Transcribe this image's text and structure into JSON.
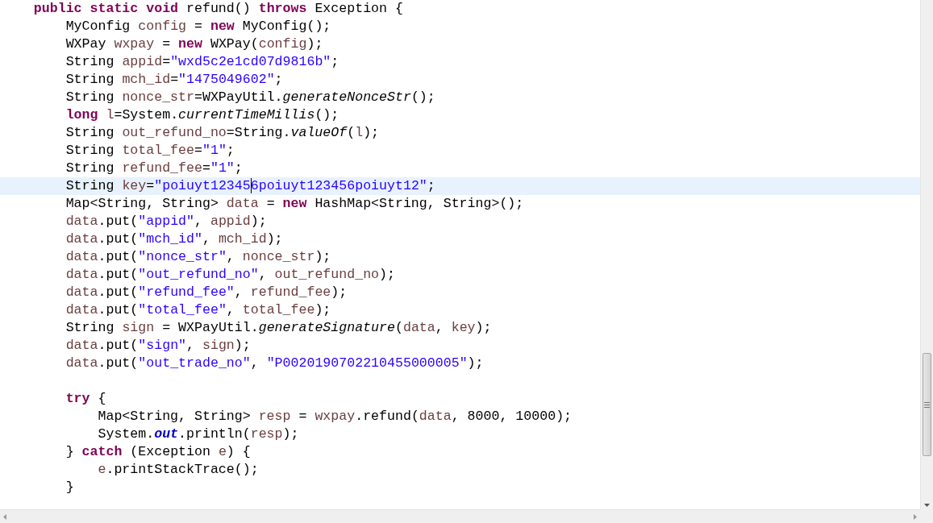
{
  "editor": {
    "lines": [
      {
        "current": false,
        "tokens": [
          {
            "text": "    public static void",
            "kind": "keyword"
          },
          {
            "text": " refund() ",
            "kind": "plain"
          },
          {
            "text": "throws",
            "kind": "keyword"
          },
          {
            "text": " Exception {",
            "kind": "plain"
          }
        ]
      },
      {
        "current": false,
        "tokens": [
          {
            "text": "        MyConfig ",
            "kind": "plain"
          },
          {
            "text": "config",
            "kind": "local"
          },
          {
            "text": " = ",
            "kind": "plain"
          },
          {
            "text": "new",
            "kind": "keyword"
          },
          {
            "text": " MyConfig();",
            "kind": "plain"
          }
        ]
      },
      {
        "current": false,
        "tokens": [
          {
            "text": "        WXPay ",
            "kind": "plain"
          },
          {
            "text": "wxpay",
            "kind": "local"
          },
          {
            "text": " = ",
            "kind": "plain"
          },
          {
            "text": "new",
            "kind": "keyword"
          },
          {
            "text": " WXPay(",
            "kind": "plain"
          },
          {
            "text": "config",
            "kind": "local"
          },
          {
            "text": ");",
            "kind": "plain"
          }
        ]
      },
      {
        "current": false,
        "tokens": [
          {
            "text": "        String ",
            "kind": "plain"
          },
          {
            "text": "appid",
            "kind": "local"
          },
          {
            "text": "=",
            "kind": "plain"
          },
          {
            "text": "\"wxd5c2e1cd07d9816b\"",
            "kind": "string"
          },
          {
            "text": ";",
            "kind": "plain"
          }
        ]
      },
      {
        "current": false,
        "tokens": [
          {
            "text": "        String ",
            "kind": "plain"
          },
          {
            "text": "mch_id",
            "kind": "local"
          },
          {
            "text": "=",
            "kind": "plain"
          },
          {
            "text": "\"1475049602\"",
            "kind": "string"
          },
          {
            "text": ";",
            "kind": "plain"
          }
        ]
      },
      {
        "current": false,
        "tokens": [
          {
            "text": "        String ",
            "kind": "plain"
          },
          {
            "text": "nonce_str",
            "kind": "local"
          },
          {
            "text": "=WXPayUtil.",
            "kind": "plain"
          },
          {
            "text": "generateNonceStr",
            "kind": "method"
          },
          {
            "text": "();",
            "kind": "plain"
          }
        ]
      },
      {
        "current": false,
        "tokens": [
          {
            "text": "        long",
            "kind": "keyword"
          },
          {
            "text": " l",
            "kind": "local"
          },
          {
            "text": "=System.",
            "kind": "plain"
          },
          {
            "text": "currentTimeMillis",
            "kind": "method"
          },
          {
            "text": "();",
            "kind": "plain"
          }
        ]
      },
      {
        "current": false,
        "tokens": [
          {
            "text": "        String ",
            "kind": "plain"
          },
          {
            "text": "out_refund_no",
            "kind": "local"
          },
          {
            "text": "=String.",
            "kind": "plain"
          },
          {
            "text": "valueOf",
            "kind": "method"
          },
          {
            "text": "(",
            "kind": "plain"
          },
          {
            "text": "l",
            "kind": "local"
          },
          {
            "text": ");",
            "kind": "plain"
          }
        ]
      },
      {
        "current": false,
        "tokens": [
          {
            "text": "        String ",
            "kind": "plain"
          },
          {
            "text": "total_fee",
            "kind": "local"
          },
          {
            "text": "=",
            "kind": "plain"
          },
          {
            "text": "\"1\"",
            "kind": "string"
          },
          {
            "text": ";",
            "kind": "plain"
          }
        ]
      },
      {
        "current": false,
        "tokens": [
          {
            "text": "        String ",
            "kind": "plain"
          },
          {
            "text": "refund_fee",
            "kind": "local"
          },
          {
            "text": "=",
            "kind": "plain"
          },
          {
            "text": "\"1\"",
            "kind": "string"
          },
          {
            "text": ";",
            "kind": "plain"
          }
        ]
      },
      {
        "current": true,
        "tokens": [
          {
            "text": "        String ",
            "kind": "plain"
          },
          {
            "text": "key",
            "kind": "local"
          },
          {
            "text": "=",
            "kind": "plain"
          },
          {
            "text": "\"poiuyt12345",
            "kind": "string"
          },
          {
            "text": "6poiuyt123456poiuyt12\"",
            "kind": "string",
            "caret": true
          },
          {
            "text": ";",
            "kind": "plain"
          }
        ]
      },
      {
        "current": false,
        "tokens": [
          {
            "text": "        Map<String, String> ",
            "kind": "plain"
          },
          {
            "text": "data",
            "kind": "local"
          },
          {
            "text": " = ",
            "kind": "plain"
          },
          {
            "text": "new",
            "kind": "keyword"
          },
          {
            "text": " HashMap<String, String>();",
            "kind": "plain"
          }
        ]
      },
      {
        "current": false,
        "tokens": [
          {
            "text": "        data",
            "kind": "local"
          },
          {
            "text": ".put(",
            "kind": "plain"
          },
          {
            "text": "\"appid\"",
            "kind": "string"
          },
          {
            "text": ", ",
            "kind": "plain"
          },
          {
            "text": "appid",
            "kind": "local"
          },
          {
            "text": ");",
            "kind": "plain"
          }
        ]
      },
      {
        "current": false,
        "tokens": [
          {
            "text": "        data",
            "kind": "local"
          },
          {
            "text": ".put(",
            "kind": "plain"
          },
          {
            "text": "\"mch_id\"",
            "kind": "string"
          },
          {
            "text": ", ",
            "kind": "plain"
          },
          {
            "text": "mch_id",
            "kind": "local"
          },
          {
            "text": ");",
            "kind": "plain"
          }
        ]
      },
      {
        "current": false,
        "tokens": [
          {
            "text": "        data",
            "kind": "local"
          },
          {
            "text": ".put(",
            "kind": "plain"
          },
          {
            "text": "\"nonce_str\"",
            "kind": "string"
          },
          {
            "text": ", ",
            "kind": "plain"
          },
          {
            "text": "nonce_str",
            "kind": "local"
          },
          {
            "text": ");",
            "kind": "plain"
          }
        ]
      },
      {
        "current": false,
        "tokens": [
          {
            "text": "        data",
            "kind": "local"
          },
          {
            "text": ".put(",
            "kind": "plain"
          },
          {
            "text": "\"out_refund_no\"",
            "kind": "string"
          },
          {
            "text": ", ",
            "kind": "plain"
          },
          {
            "text": "out_refund_no",
            "kind": "local"
          },
          {
            "text": ");",
            "kind": "plain"
          }
        ]
      },
      {
        "current": false,
        "tokens": [
          {
            "text": "        data",
            "kind": "local"
          },
          {
            "text": ".put(",
            "kind": "plain"
          },
          {
            "text": "\"refund_fee\"",
            "kind": "string"
          },
          {
            "text": ", ",
            "kind": "plain"
          },
          {
            "text": "refund_fee",
            "kind": "local"
          },
          {
            "text": ");",
            "kind": "plain"
          }
        ]
      },
      {
        "current": false,
        "tokens": [
          {
            "text": "        data",
            "kind": "local"
          },
          {
            "text": ".put(",
            "kind": "plain"
          },
          {
            "text": "\"total_fee\"",
            "kind": "string"
          },
          {
            "text": ", ",
            "kind": "plain"
          },
          {
            "text": "total_fee",
            "kind": "local"
          },
          {
            "text": ");",
            "kind": "plain"
          }
        ]
      },
      {
        "current": false,
        "tokens": [
          {
            "text": "        String ",
            "kind": "plain"
          },
          {
            "text": "sign",
            "kind": "local"
          },
          {
            "text": " = WXPayUtil.",
            "kind": "plain"
          },
          {
            "text": "generateSignature",
            "kind": "method"
          },
          {
            "text": "(",
            "kind": "plain"
          },
          {
            "text": "data",
            "kind": "local"
          },
          {
            "text": ", ",
            "kind": "plain"
          },
          {
            "text": "key",
            "kind": "local"
          },
          {
            "text": ");",
            "kind": "plain"
          }
        ]
      },
      {
        "current": false,
        "tokens": [
          {
            "text": "        data",
            "kind": "local"
          },
          {
            "text": ".put(",
            "kind": "plain"
          },
          {
            "text": "\"sign\"",
            "kind": "string"
          },
          {
            "text": ", ",
            "kind": "plain"
          },
          {
            "text": "sign",
            "kind": "local"
          },
          {
            "text": ");",
            "kind": "plain"
          }
        ]
      },
      {
        "current": false,
        "tokens": [
          {
            "text": "        data",
            "kind": "local"
          },
          {
            "text": ".put(",
            "kind": "plain"
          },
          {
            "text": "\"out_trade_no\"",
            "kind": "string"
          },
          {
            "text": ", ",
            "kind": "plain"
          },
          {
            "text": "\"P0020190702210455000005\"",
            "kind": "string"
          },
          {
            "text": ");",
            "kind": "plain"
          }
        ]
      },
      {
        "current": false
      },
      {
        "current": false,
        "tokens": [
          {
            "text": "        try",
            "kind": "keyword"
          },
          {
            "text": " {",
            "kind": "plain"
          }
        ]
      },
      {
        "current": false,
        "tokens": [
          {
            "text": "            Map<String, String> ",
            "kind": "plain"
          },
          {
            "text": "resp",
            "kind": "local"
          },
          {
            "text": " = ",
            "kind": "plain"
          },
          {
            "text": "wxpay",
            "kind": "local"
          },
          {
            "text": ".refund(",
            "kind": "plain"
          },
          {
            "text": "data",
            "kind": "local"
          },
          {
            "text": ", 8000, 10000);",
            "kind": "plain"
          }
        ]
      },
      {
        "current": false,
        "tokens": [
          {
            "text": "            System.",
            "kind": "plain"
          },
          {
            "text": "out",
            "kind": "field"
          },
          {
            "text": ".println(",
            "kind": "plain"
          },
          {
            "text": "resp",
            "kind": "local"
          },
          {
            "text": ");",
            "kind": "plain"
          }
        ]
      },
      {
        "current": false,
        "tokens": [
          {
            "text": "        } ",
            "kind": "plain"
          },
          {
            "text": "catch",
            "kind": "keyword"
          },
          {
            "text": " (Exception ",
            "kind": "plain"
          },
          {
            "text": "e",
            "kind": "local"
          },
          {
            "text": ") {",
            "kind": "plain"
          }
        ]
      },
      {
        "current": false,
        "tokens": [
          {
            "text": "            e",
            "kind": "local"
          },
          {
            "text": ".printStackTrace();",
            "kind": "plain"
          }
        ]
      },
      {
        "current": false,
        "tokens": [
          {
            "text": "        }",
            "kind": "plain"
          }
        ]
      }
    ]
  }
}
